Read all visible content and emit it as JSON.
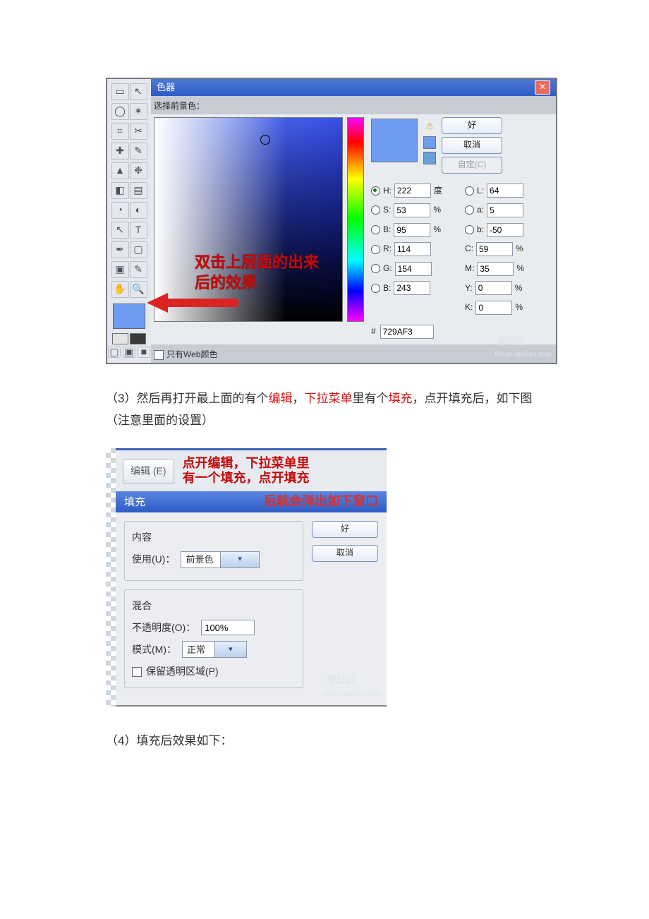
{
  "figure1": {
    "title": "色器",
    "label_select_fg": "选择前景色：",
    "annotation_line1": "双击上层面的出来",
    "annotation_line2": "后的效果",
    "web_only": "只有Web颜色",
    "buttons": {
      "ok": "好",
      "cancel": "取消",
      "custom": "自定(C)"
    },
    "fields": {
      "H_label": "H:",
      "H_val": "222",
      "H_unit": "度",
      "S_label": "S:",
      "S_val": "53",
      "S_unit": "%",
      "Br_label": "B:",
      "Br_val": "95",
      "Br_unit": "%",
      "L_label": "L:",
      "L_val": "64",
      "a_label": "a:",
      "a_val": "5",
      "b_label": "b:",
      "b_val": "-50",
      "R_label": "R:",
      "R_val": "114",
      "G_label": "G:",
      "G_val": "154",
      "Bl_label": "B:",
      "Bl_val": "243",
      "C_label": "C:",
      "C_val": "59",
      "C_unit": "%",
      "M_label": "M:",
      "M_val": "35",
      "M_unit": "%",
      "Y_label": "Y:",
      "Y_val": "0",
      "Y_unit": "%",
      "K_label": "K:",
      "K_val": "0",
      "K_unit": "%",
      "hex_prefix": "#",
      "hex_val": "729AF3"
    },
    "watermark": "淘社区",
    "watermark_sub": "forum.taobao.com"
  },
  "para3": {
    "prefix": "（3）然后再打开最上面的有个",
    "kw1": "编辑",
    "mid1": "，",
    "kw2": "下拉菜单",
    "mid2": "里有个",
    "kw3": "填充",
    "mid3": "，点开填充后，如下图（注意里面的设置）"
  },
  "figure2": {
    "menu_btn": "编辑 (E)",
    "anno_line1": "点开编辑，下拉菜单里",
    "anno_line2": "有一个填充，点开填充",
    "anno_line3": "后就会弹出如下窗口",
    "dlg_title": "填充",
    "section_content": "内容",
    "use_label": "使用(U)：",
    "use_value": "前景色",
    "section_mix": "混合",
    "opacity_label": "不透明度(O)：",
    "opacity_value": "100%",
    "mode_label": "模式(M)：",
    "mode_value": "正常",
    "preserve_alpha": "保留透明区域(P)",
    "btn_ok": "好",
    "btn_cancel": "取消",
    "watermark": "淘社区",
    "watermark_sub": "forum.taobao.com"
  },
  "para4": "（4）填充后效果如下："
}
